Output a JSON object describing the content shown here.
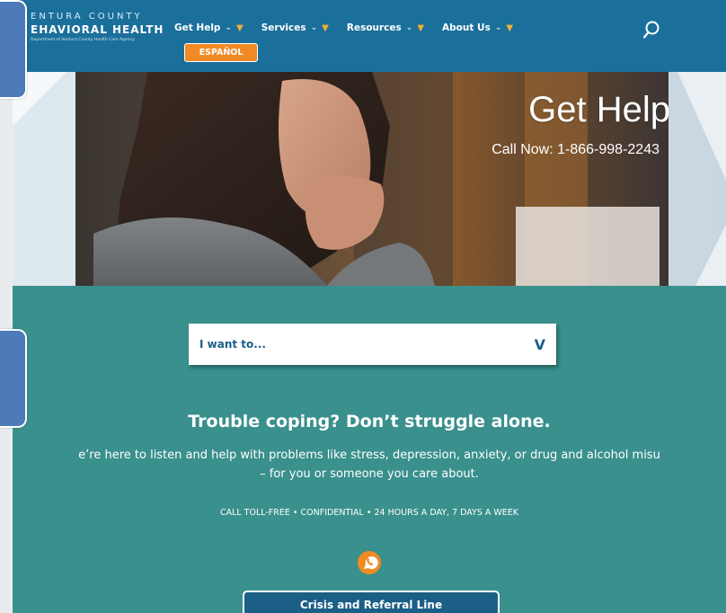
{
  "header": {
    "logo_line1": "ENTURA COUNTY",
    "logo_line2": "EHAVIORAL HEALTH",
    "logo_line3": "Department of Ventura County Health Care Agency",
    "nav": [
      {
        "label": "Get Help"
      },
      {
        "label": "Services"
      },
      {
        "label": "Resources"
      },
      {
        "label": "About Us"
      }
    ],
    "espanol_label": "ESPAÑOL",
    "search_icon": "search-icon"
  },
  "hero": {
    "title": "Get Help",
    "subtitle": "Call Now: 1-866-998-2243"
  },
  "main": {
    "select_label": "I want to...",
    "select_chevron": "V",
    "headline": "Trouble coping? Don’t struggle alone.",
    "body_line1": "e’re here to listen and help with problems like stress, depression, anxiety, or drug and alcohol misu",
    "body_line2": "– for you or someone you care about.",
    "tollfree": "CALL TOLL-FREE • CONFIDENTIAL • 24 HOURS A DAY, 7 DAYS A WEEK",
    "phone_icon": "phone-icon",
    "crisis_button": "Crisis and Referral Line"
  },
  "colors": {
    "header_blue": "#1b6f9b",
    "teal": "#39908d",
    "orange": "#f08a24",
    "dark_blue": "#1b5f87",
    "side_tab": "#4d7ab8"
  }
}
